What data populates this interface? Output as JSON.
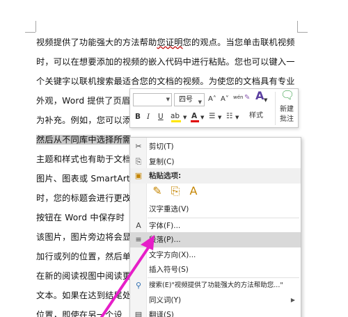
{
  "document": {
    "lines": [
      {
        "pre": "视频提供了功能强大的方法帮助",
        "ul": "您证明",
        "post": "您的观点。当您单击联机视频"
      },
      {
        "pre": "时，可以在想要添加的视频的嵌入代码中进行粘贴。您也可以键入一",
        "ul": "",
        "post": ""
      },
      {
        "pre": "个关键字以联机搜索最适合您的文档的视频。为使您的文档具有专业",
        "ul": "",
        "post": ""
      },
      {
        "pre": "外观，Word 提供了页眉",
        "ul": "",
        "post": ""
      },
      {
        "pre": "为补充。例如，您可以添",
        "ul": "",
        "post": ""
      },
      {
        "pre": "然后从不同库中选择所需",
        "ul": "",
        "post": ""
      },
      {
        "pre": "主题和样式也有助于文档",
        "ul": "",
        "post": ""
      },
      {
        "pre": "图片、图表或 SmartArt",
        "ul": "",
        "post": ""
      },
      {
        "pre": "时，您的标题会进行更改",
        "ul": "",
        "post": ""
      },
      {
        "pre": "按钮在 Word 中保存时",
        "ul": "",
        "post": ""
      },
      {
        "pre": "该图片，图片旁边将会显",
        "ul": "",
        "post": ""
      },
      {
        "pre": "加行或列的位置，然后单",
        "ul": "",
        "post": ""
      },
      {
        "pre": "在新的阅读视图中阅读更",
        "ul": "",
        "post": ""
      },
      {
        "pre": "文本。如果在达到结尾处",
        "ul": "",
        "post": ""
      },
      {
        "pre": "位置，即使在另一个设",
        "ul": "",
        "post": ""
      }
    ]
  },
  "mini_toolbar": {
    "font_size": "四号",
    "bold": "B",
    "italic": "I",
    "underline": "U",
    "grow_font": "A˄",
    "shrink_font": "A˅",
    "phonetic": "wén",
    "styles_label": "样式",
    "new_comment_label_1": "新建",
    "new_comment_label_2": "批注"
  },
  "context_menu": {
    "items": [
      {
        "label": "剪切(T)",
        "icon": "✂"
      },
      {
        "label": "复制(C)",
        "icon": "⎘"
      },
      {
        "label": "粘贴选项:",
        "icon": "📋"
      },
      {
        "label": "汉字重选(V)",
        "icon": ""
      },
      {
        "label": "字体(F)...",
        "icon": "A"
      },
      {
        "label": "段落(P)...",
        "icon": "≡"
      },
      {
        "label": "文字方向(X)...",
        "icon": ""
      },
      {
        "label": "插入符号(S)",
        "icon": ""
      },
      {
        "label": "搜索(E)\"视频提供了功能强大的方法帮助您...\"",
        "icon": "⚲"
      },
      {
        "label": "同义词(Y)",
        "icon": ""
      },
      {
        "label": "翻译(S)",
        "icon": "▤"
      }
    ]
  },
  "colors": {
    "arrow": "#e61ec8",
    "highlight": "#d9d9d9"
  }
}
